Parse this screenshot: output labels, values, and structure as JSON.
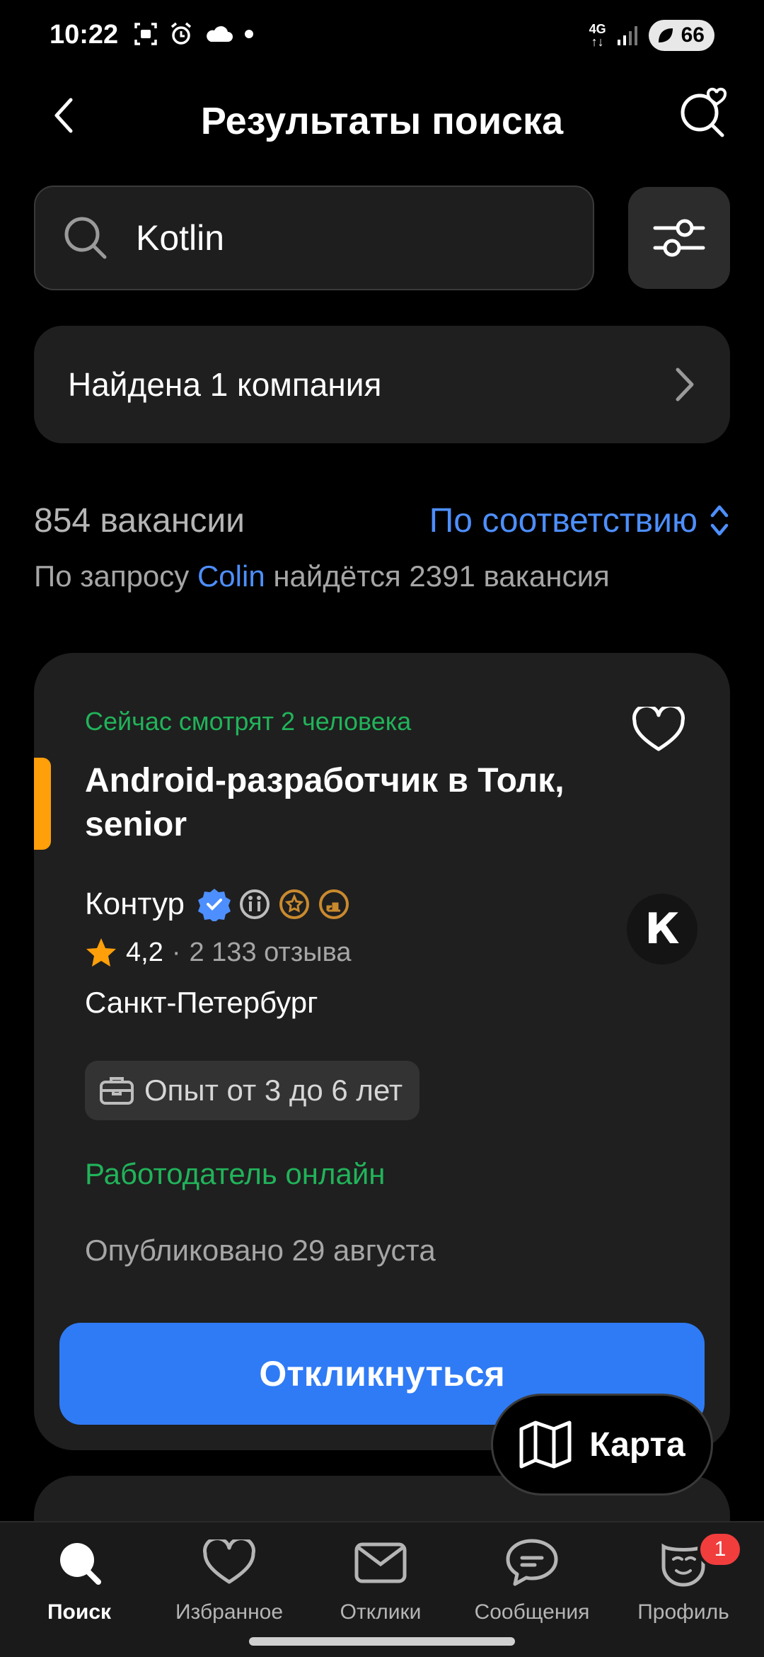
{
  "status_bar": {
    "time": "10:22",
    "network": "4G",
    "battery": "66"
  },
  "header": {
    "title": "Результаты поиска"
  },
  "search": {
    "query": "Kotlin",
    "placeholder": ""
  },
  "companies": {
    "label": "Найдена 1 компания"
  },
  "results": {
    "count": "854 вакансии",
    "sort_label": "По соответствию",
    "hint_prefix": "По запросу",
    "hint_query": "Colin",
    "hint_suffix": "найдётся 2391 вакансия"
  },
  "vacancy": {
    "viewers": "Сейчас смотрят 2 человека",
    "title": "Android-разработчик в Толк, senior",
    "company": "Контур",
    "rating": "4,2",
    "reviews": "2 133 отзыва",
    "city": "Санкт-Петербург",
    "experience": "Опыт от 3 до 6 лет",
    "employer_status": "Работодатель онлайн",
    "published": "Опубликовано 29 августа",
    "apply_label": "Откликнуться",
    "logo_letter": "К"
  },
  "map_button": {
    "label": "Карта"
  },
  "bottom_nav": {
    "items": [
      {
        "label": "Поиск",
        "icon": "search-icon"
      },
      {
        "label": "Избранное",
        "icon": "heart-icon"
      },
      {
        "label": "Отклики",
        "icon": "envelope-icon"
      },
      {
        "label": "Сообщения",
        "icon": "chat-icon"
      },
      {
        "label": "Профиль",
        "icon": "profile-icon"
      }
    ],
    "profile_badge": "1"
  },
  "colors": {
    "accent": "#2f7bf5",
    "link": "#4d8fff",
    "green": "#21b35a",
    "orange": "#ff9f0a",
    "badge": "#f23d3d"
  }
}
